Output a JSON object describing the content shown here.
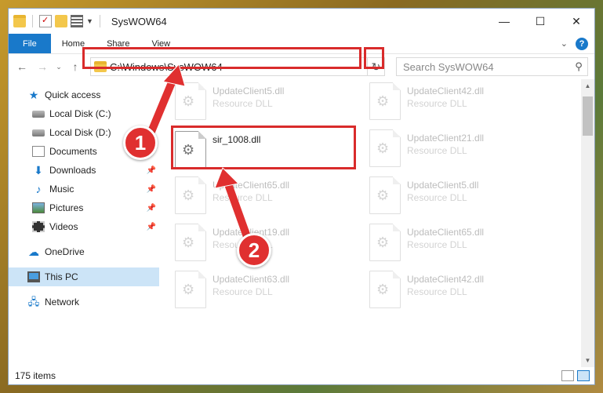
{
  "window": {
    "title": "SysWOW64"
  },
  "ribbon": {
    "tabs": [
      "File",
      "Home",
      "Share",
      "View"
    ]
  },
  "nav": {
    "back": "←",
    "forward": "→",
    "up": "↑"
  },
  "address": {
    "path": "C:\\Windows\\SysWOW64"
  },
  "search": {
    "placeholder": "Search SysWOW64"
  },
  "sidebar": {
    "items": [
      {
        "label": "Quick access",
        "icon": "star-icon"
      },
      {
        "label": "Local Disk (C:)",
        "icon": "drive-icon"
      },
      {
        "label": "Local Disk (D:)",
        "icon": "drive-icon"
      },
      {
        "label": "Documents",
        "icon": "documents-icon"
      },
      {
        "label": "Downloads",
        "icon": "downloads-icon"
      },
      {
        "label": "Music",
        "icon": "music-icon"
      },
      {
        "label": "Pictures",
        "icon": "pictures-icon"
      },
      {
        "label": "Videos",
        "icon": "videos-icon"
      },
      {
        "label": "OneDrive",
        "icon": "onedrive-icon"
      },
      {
        "label": "This PC",
        "icon": "computer-icon"
      },
      {
        "label": "Network",
        "icon": "network-icon"
      }
    ]
  },
  "files": [
    {
      "name": "UpdateClient5.dll",
      "type": "Resource DLL"
    },
    {
      "name": "UpdateClient42.dll",
      "type": "Resource DLL"
    },
    {
      "name": "sir_1008.dll",
      "type": ""
    },
    {
      "name": "UpdateClient21.dll",
      "type": "Resource DLL"
    },
    {
      "name": "UpdateClient65.dll",
      "type": "Resource DLL"
    },
    {
      "name": "UpdateClient5.dll",
      "type": "Resource DLL"
    },
    {
      "name": "UpdateClient19.dll",
      "type": "Resource DLL"
    },
    {
      "name": "UpdateClient65.dll",
      "type": "Resource DLL"
    },
    {
      "name": "UpdateClient63.dll",
      "type": "Resource DLL"
    },
    {
      "name": "UpdateClient42.dll",
      "type": "Resource DLL"
    }
  ],
  "status": {
    "count": "175 items"
  },
  "callouts": [
    "1",
    "2"
  ],
  "colors": {
    "accent": "#1979ca",
    "highlight": "#d92b2b",
    "badge": "#e03030"
  }
}
